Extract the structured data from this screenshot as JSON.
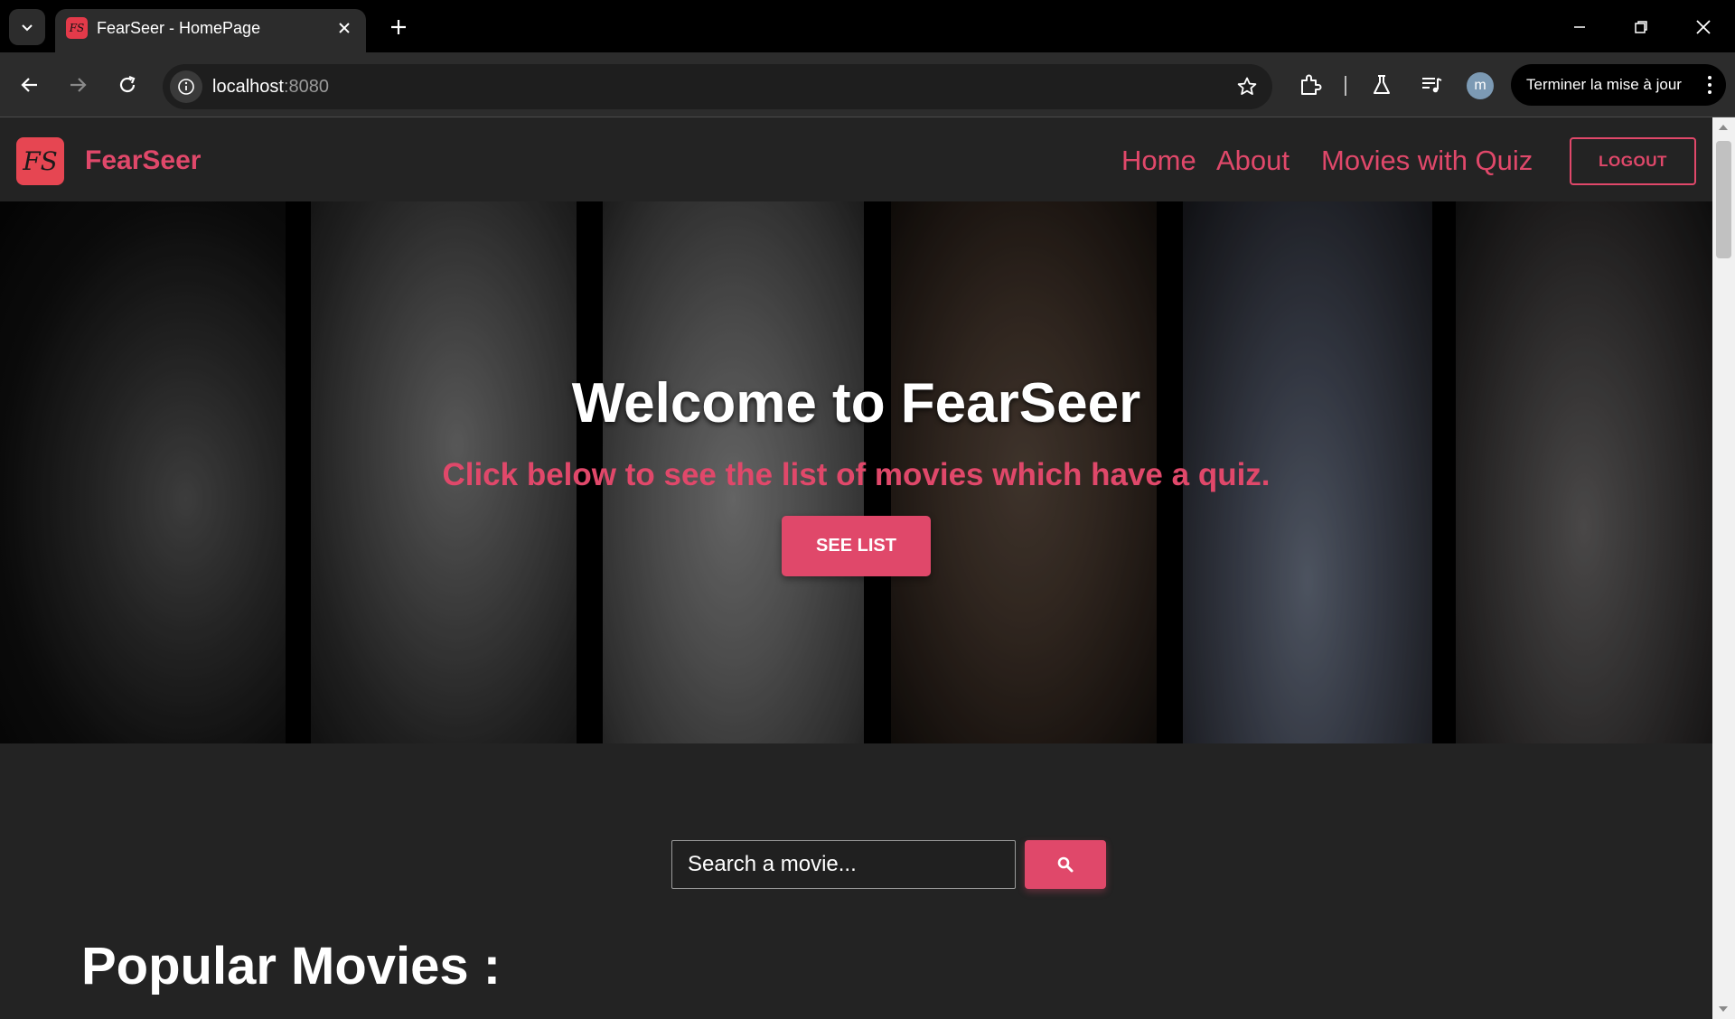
{
  "browser": {
    "tab_title": "FearSeer - HomePage",
    "url_host": "localhost",
    "url_port": ":8080",
    "update_label": "Terminer la mise à jour",
    "profile_initial": "m"
  },
  "site": {
    "logo_text": "FS",
    "brand": "FearSeer",
    "nav": {
      "home": "Home",
      "about": "About",
      "movies_quiz": "Movies with Quiz",
      "logout": "LOGOUT"
    },
    "hero": {
      "title": "Welcome to FearSeer",
      "subtitle": "Click below to see the list of movies which have a quiz.",
      "button": "SEE LIST"
    },
    "search": {
      "placeholder": "Search a movie..."
    },
    "popular_title": "Popular Movies :"
  },
  "colors": {
    "accent": "#e0486a",
    "page_bg": "#232323",
    "chrome_bg": "#2c2c2c"
  }
}
